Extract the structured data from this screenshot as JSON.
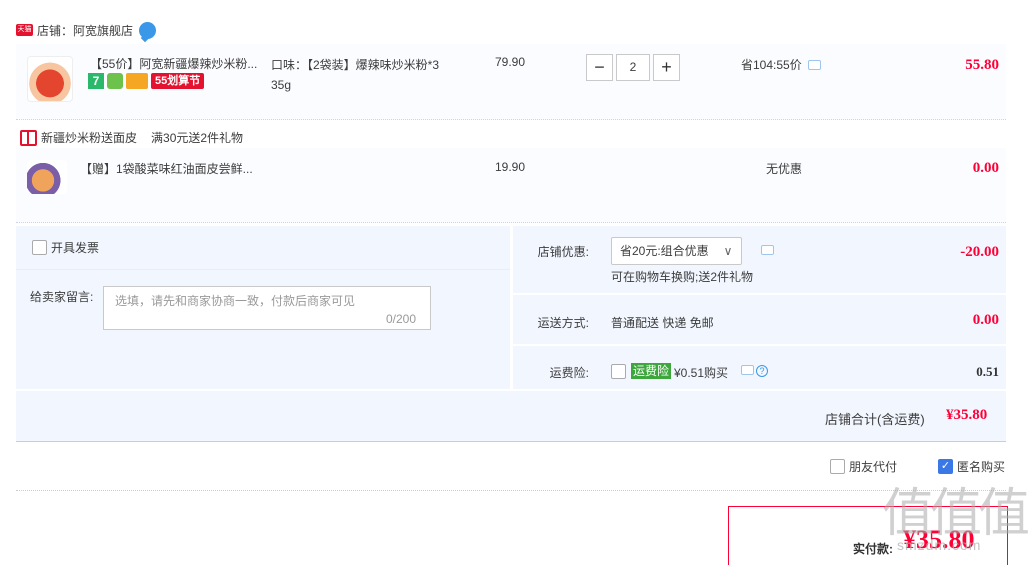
{
  "shop": {
    "badge": "天猫",
    "label": "店铺：阿宽旗舰店"
  },
  "item1": {
    "title": "【55价】阿宽新疆爆辣炒米粉...",
    "badge_7": "7",
    "badge_55": "55划算节",
    "sku": "口味：【2袋装】爆辣味炒米粉*3 35g",
    "price": "79.90",
    "qty_minus": "−",
    "qty": "2",
    "qty_plus": "+",
    "discount": "省104:55价",
    "total": "55.80"
  },
  "gift": {
    "promo_name": "新疆炒米粉送面皮",
    "promo_rule": "满30元送2件礼物",
    "title": "【赠】1袋酸菜味红油面皮尝鲜...",
    "price": "19.90",
    "discount": "无优惠",
    "total": "0.00"
  },
  "invoice": {
    "label": "开具发票"
  },
  "message": {
    "label": "给卖家留言:",
    "placeholder": "选填，请先和商家协商一致，付款后商家可见",
    "count": "0/200"
  },
  "shop_promo": {
    "label": "店铺优惠:",
    "selected": "省20元:组合优惠",
    "arrow": "∨",
    "note": "可在购物车换购;送2件礼物",
    "value": "-20.00"
  },
  "shipping": {
    "label": "运送方式:",
    "method": "普通配送 快递 免邮",
    "value": "0.00"
  },
  "insurance": {
    "label": "运费险:",
    "tag": "运费险",
    "price": "¥0.51购买",
    "help": "?",
    "value": "0.51"
  },
  "summary": {
    "label": "店铺合计(含运费)",
    "value": "¥35.80"
  },
  "options": {
    "friend_pay": "朋友代付",
    "anonymous": "匿名购买",
    "check": "✓"
  },
  "payment": {
    "label": "实付款:",
    "value": "¥35.80"
  },
  "watermark": {
    "logo": "值值值",
    "site": "smzdm.com"
  },
  "colors": {
    "accent": "#ff0036",
    "panel_bg": "#f2f7ff",
    "row_bg": "#fbfcff",
    "checkbox_blue": "#3b78e7",
    "insurance_green": "#3da73d"
  }
}
